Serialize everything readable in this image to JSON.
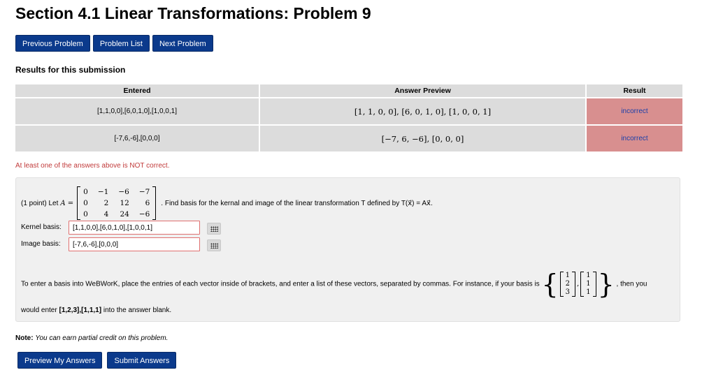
{
  "page": {
    "title": "Section 4.1 Linear Transformations: Problem 9"
  },
  "nav": {
    "prev": "Previous Problem",
    "list": "Problem List",
    "next": "Next Problem"
  },
  "results": {
    "heading": "Results for this submission",
    "columns": [
      "Entered",
      "Answer Preview",
      "Result"
    ],
    "rows": [
      {
        "entered": "[1,1,0,0],[6,0,1,0],[1,0,0,1]",
        "preview": "[1, 1, 0, 0], [6, 0, 1, 0], [1, 0, 0, 1]",
        "result": "incorrect"
      },
      {
        "entered": "[-7,6,-6],[0,0,0]",
        "preview": "[−7, 6, −6], [0, 0, 0]",
        "result": "incorrect"
      }
    ],
    "warning": "At least one of the answers above is NOT correct."
  },
  "problem": {
    "prefix": "(1 point) Let",
    "matrix_lhs": "A =",
    "matrix": [
      [
        "0",
        "−1",
        "−6",
        "−7"
      ],
      [
        "0",
        "2",
        "12",
        "6"
      ],
      [
        "0",
        "4",
        "24",
        "−6"
      ]
    ],
    "description": ". Find basis for the kernal and image of the linear transformation T defined by T(x⃗) = Ax⃗.",
    "kernel_label": "Kernel basis:",
    "kernel_value": "[1,1,0,0],[6,0,1,0],[1,0,0,1]",
    "image_label": "Image basis:",
    "image_value": "[-7,6,-6],[0,0,0]",
    "instr_before": "To enter a basis into WeBWorK, place the entries of each vector inside of brackets, and enter a list of these vectors, separated by commas. For instance, if your basis is",
    "example_vectors": [
      [
        "1",
        "2",
        "3"
      ],
      [
        "1",
        "1",
        "1"
      ]
    ],
    "instr_after": ", then you",
    "instr_line2_pre": "would enter",
    "instr_line2_bold": "[1,2,3],[1,1,1]",
    "instr_line2_post": "into the answer blank."
  },
  "note": {
    "label": "Note:",
    "text": "You can earn partial credit on this problem."
  },
  "buttons": {
    "preview": "Preview My Answers",
    "submit": "Submit Answers"
  }
}
